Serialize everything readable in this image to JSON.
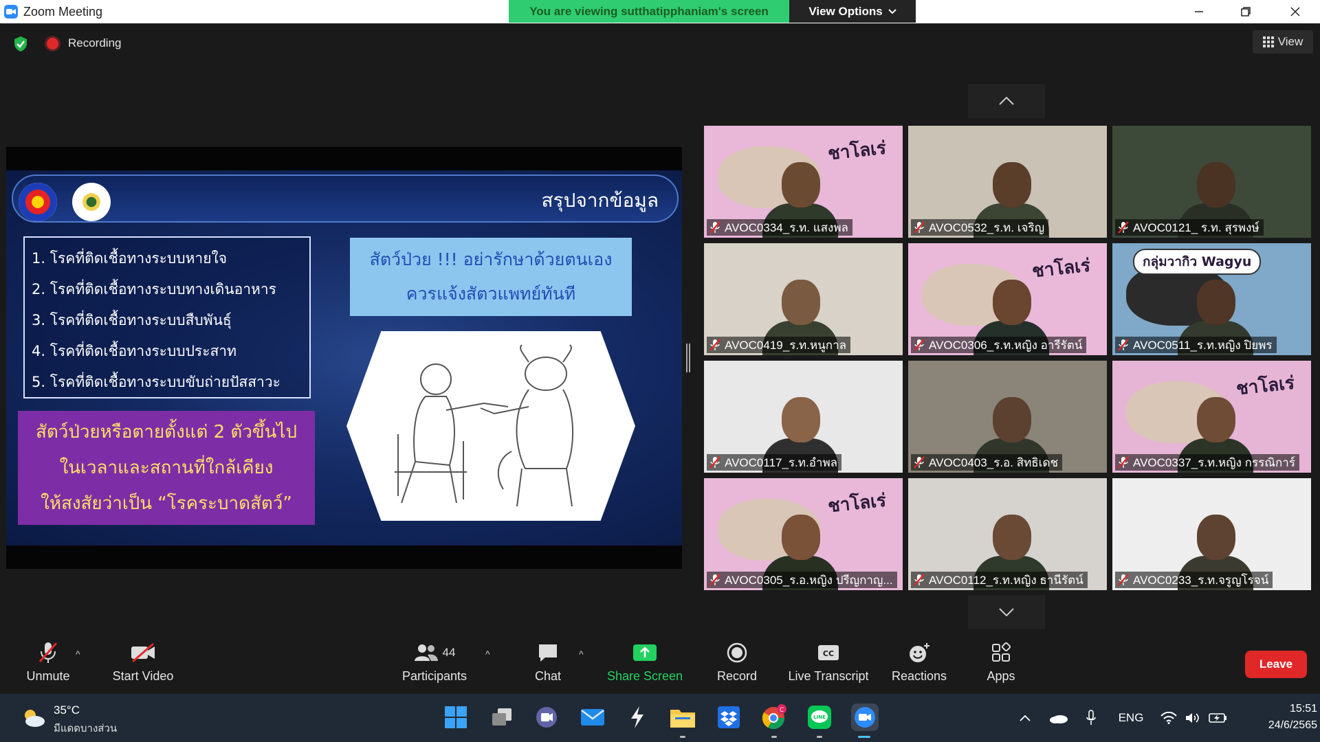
{
  "window": {
    "title": "Zoom Meeting"
  },
  "banner": {
    "viewing_text": "You are viewing sutthatipphaniam's screen",
    "view_options_label": "View Options"
  },
  "status": {
    "recording_label": "Recording",
    "view_label": "View"
  },
  "slide": {
    "title": "สรุปจากข้อมูล",
    "list": [
      "1. โรคที่ติดเชื้อทางระบบหายใจ",
      "2. โรคที่ติดเชื้อทางระบบทางเดินอาหาร",
      "3. โรคที่ติดเชื้อทางระบบสืบพันธุ์",
      "4. โรคที่ติดเชื้อทางระบบประสาท",
      "5. โรคที่ติดเชื้อทางระบบขับถ่ายปัสสาวะ"
    ],
    "purple_lines": [
      "สัตว์ป่วยหรือตายตั้งแต่ 2 ตัวขึ้นไป",
      "ในเวลาและสถานที่ใกล้เคียง",
      "ให้สงสัยว่าเป็น “โรคระบาดสัตว์”"
    ],
    "blue_lines": [
      "สัตว์ป่วย !!! อย่ารักษาด้วยตนเอง",
      "ควรแจ้งสัตวแพทย์ทันที"
    ]
  },
  "participants": [
    {
      "name": "AVOC0334_ร.ท. แสงพล",
      "badge": "ชาโลเร่",
      "bg": "#e9b7d8"
    },
    {
      "name": "AVOC0532_ร.ท. เจริญ",
      "badge": "",
      "bg": "#c9c2b5"
    },
    {
      "name": "AVOC0121_ ร.ท. สุรพงษ์",
      "badge": "",
      "bg": "#3d4a3a"
    },
    {
      "name": "AVOC0419_ร.ท.หนูกาล",
      "badge": "",
      "bg": "#d8d2c8"
    },
    {
      "name": "AVOC0306_ร.ท.หญิง อารีรัตน์",
      "badge": "ชาโลเร่",
      "bg": "#eab9da"
    },
    {
      "name": "AVOC0511_ร.ท.หญิง ปิยพร",
      "badge": "กลุ่มวากิว Wagyu",
      "bg": "#7fa8c9"
    },
    {
      "name": "AVOC0117_ร.ท.อำพล",
      "badge": "",
      "bg": "#e8e8e8"
    },
    {
      "name": "AVOC0403_ร.อ. สิทธิเดช",
      "badge": "",
      "bg": "#8a8578"
    },
    {
      "name": "AVOC0337_ร.ท.หญิง กรรณิการ์",
      "badge": "ชาโลเร่",
      "bg": "#e6b5d6"
    },
    {
      "name": "AVOC0305_ร.อ.หญิง ปรีญกาญ...",
      "badge": "ชาโลเร่",
      "bg": "#e9b8d8"
    },
    {
      "name": "AVOC0112_ร.ท.หญิง ธานีรัตน์",
      "badge": "",
      "bg": "#d6d3cf"
    },
    {
      "name": "AVOC0233_ร.ท.จรูญโรจน์",
      "badge": "",
      "bg": "#eeeeee"
    }
  ],
  "toolbar": {
    "unmute": "Unmute",
    "start_video": "Start Video",
    "participants": "Participants",
    "participants_count": "44",
    "chat": "Chat",
    "share_screen": "Share Screen",
    "record": "Record",
    "live_transcript": "Live Transcript",
    "reactions": "Reactions",
    "apps": "Apps",
    "leave": "Leave"
  },
  "taskbar": {
    "temperature": "35°C",
    "weather": "มีแดดบางส่วน",
    "language": "ENG",
    "time": "15:51",
    "date": "24/6/2565",
    "chrome_badge": "C"
  },
  "colors": {
    "zoom_blue": "#2d8cff",
    "banner_green": "#2fcc71",
    "leave_red": "#e02828",
    "share_green": "#23d160"
  }
}
